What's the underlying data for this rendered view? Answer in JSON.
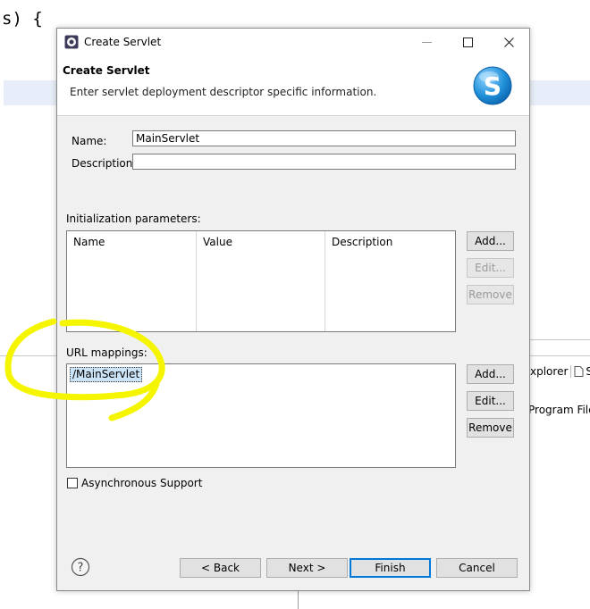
{
  "background": {
    "code_fragment": "s) {",
    "tab_explorer": "xplorer",
    "tab_s": "S",
    "path_text": "Program Files"
  },
  "dialog": {
    "window_title": "Create Servlet",
    "header_title": "Create Servlet",
    "header_description": "Enter servlet deployment descriptor specific information.",
    "name_label": "Name:",
    "name_value": "MainServlet",
    "description_label": "Description:",
    "description_value": "",
    "init_params_label": "Initialization parameters:",
    "init_params_columns": [
      "Name",
      "Value",
      "Description"
    ],
    "init_add": "Add...",
    "init_edit": "Edit...",
    "init_remove": "Remove",
    "url_mappings_label": "URL mappings:",
    "url_mappings": [
      "/MainServlet"
    ],
    "url_add": "Add...",
    "url_edit": "Edit...",
    "url_remove": "Remove",
    "async_label": "Asynchronous Support",
    "async_checked": false,
    "back": "< Back",
    "next": "Next >",
    "finish": "Finish",
    "cancel": "Cancel"
  },
  "icons": {
    "title": "eclipse-gear-icon",
    "logo": "servlet-s-logo-icon",
    "help": "help-icon",
    "minimize": "minimize-icon",
    "maximize": "maximize-icon",
    "close": "close-icon",
    "file": "file-icon"
  },
  "colors": {
    "accent": "#0078d7",
    "annotation": "#f5f500",
    "selection": "#cce4f7",
    "logo": "#1e8fd8"
  }
}
